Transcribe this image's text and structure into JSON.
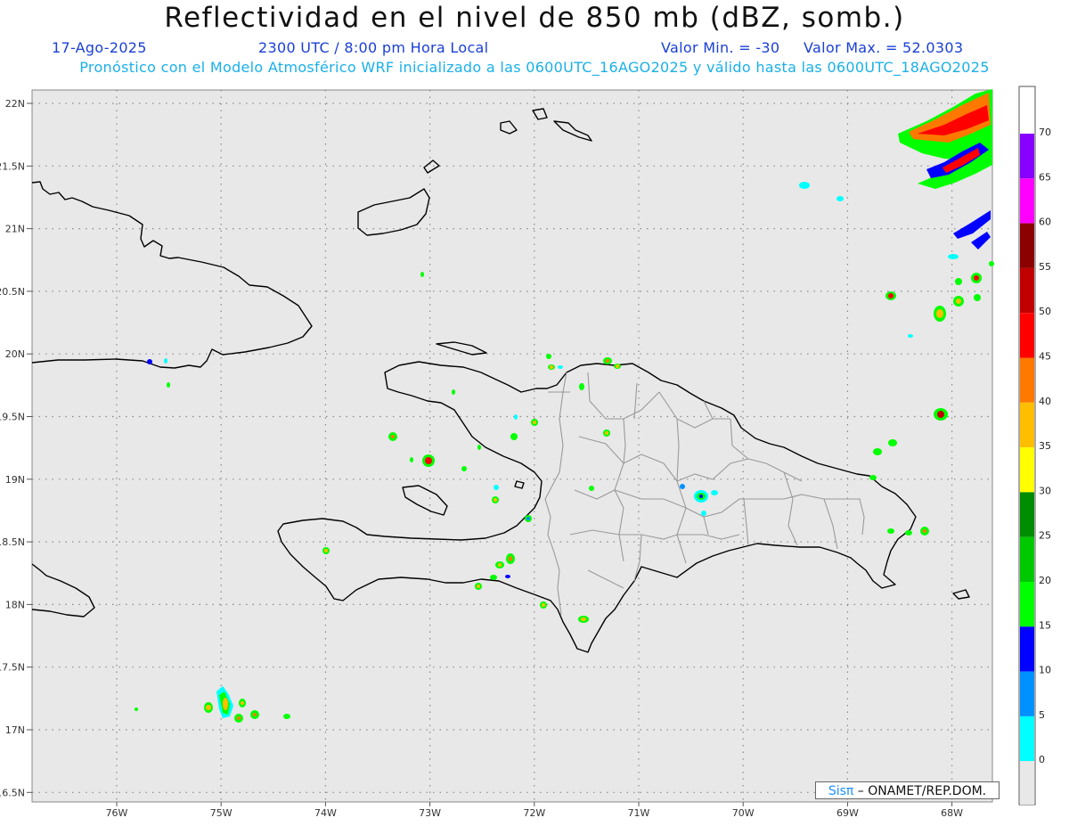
{
  "header": {
    "title": "Reflectividad en el nivel de 850 mb (dBZ, somb.)",
    "date": "17-Ago-2025",
    "time": "2300 UTC / 8:00 pm Hora Local",
    "valmin": "Valor Min. = -30",
    "valmax": "Valor Max. = 52.0303",
    "forecast": "Pronóstico con el Modelo Atmosférico WRF inicializado a las 0600UTC_16AGO2025 y válido hasta las  0600UTC_18AGO2025"
  },
  "credit": {
    "sis": "Sisπ",
    "text": " – ONAMET/REP.DOM."
  },
  "axes": {
    "lon_ticks": [
      "76W",
      "75W",
      "74W",
      "73W",
      "72W",
      "71W",
      "70W",
      "69W",
      "68W"
    ],
    "lat_ticks": [
      "22N",
      "21.5N",
      "21N",
      "20.5N",
      "20N",
      "19.5N",
      "19N",
      "18.5N",
      "18N",
      "17.5N",
      "17N",
      "16.5N"
    ]
  },
  "colorbar": {
    "labels": [
      "70",
      "65",
      "60",
      "55",
      "50",
      "45",
      "40",
      "35",
      "30",
      "25",
      "20",
      "15",
      "10",
      "5",
      "0"
    ],
    "colors": [
      "#8800ff",
      "#ff00ff",
      "#8b0000",
      "#c00000",
      "#ff0000",
      "#ff7800",
      "#ffbe00",
      "#ffff00",
      "#008c00",
      "#00c800",
      "#00ff00",
      "#0000ff",
      "#0090ff",
      "#00ffff",
      "#e8e8e8"
    ]
  }
}
